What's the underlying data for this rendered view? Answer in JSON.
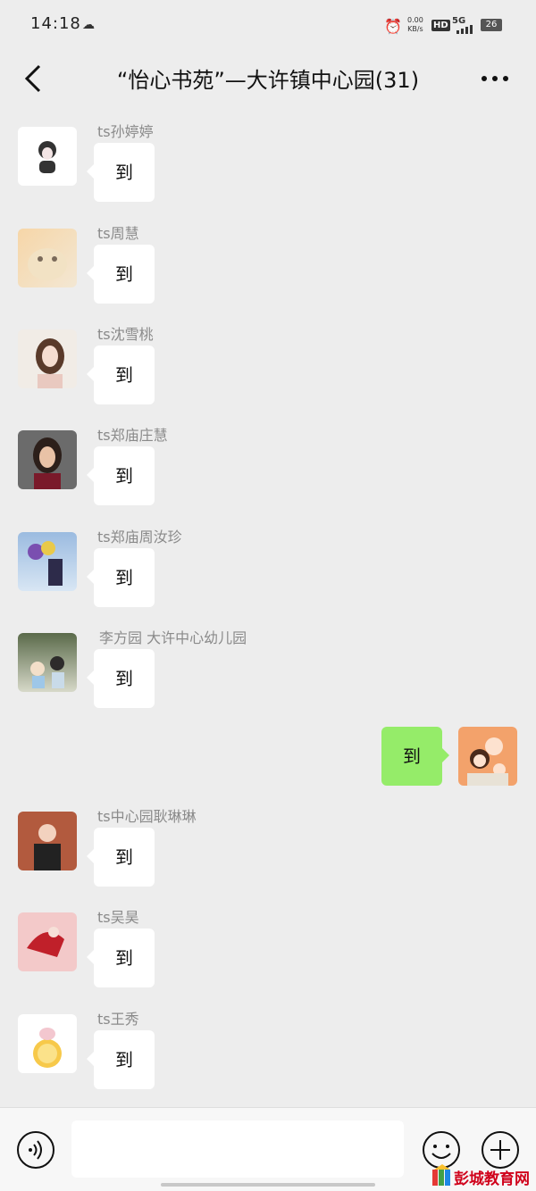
{
  "status_bar": {
    "time": "14:18",
    "net_speed": "0.00",
    "net_unit": "KB/s",
    "hd": "HD",
    "signal": "5G",
    "battery": "26"
  },
  "header": {
    "title": "“怡心书苑”—大许镇中心园(31)"
  },
  "messages": [
    {
      "name": "ts孙婷婷",
      "text": "到"
    },
    {
      "name": "ts周慧",
      "text": "到"
    },
    {
      "name": "ts沈雪桃",
      "text": "到"
    },
    {
      "name": "ts郑庙庄慧",
      "text": "到"
    },
    {
      "name": "ts郑庙周汝珍",
      "text": "到"
    },
    {
      "name": "李方园  大许中心幼儿园",
      "text": "到"
    },
    {
      "name": "",
      "text": "到",
      "self": true
    },
    {
      "name": "ts中心园耿琳琳",
      "text": "到"
    },
    {
      "name": "ts吴昊",
      "text": "到"
    },
    {
      "name": "ts王秀",
      "text": "到"
    }
  ],
  "input_bar": {
    "icons": [
      "voice-icon",
      "emoji-icon",
      "plus-icon"
    ]
  },
  "watermark": {
    "text": "彭城教育网"
  },
  "colors": {
    "background": "#ededed",
    "self_bubble": "#95ec69",
    "other_bubble": "#ffffff"
  }
}
